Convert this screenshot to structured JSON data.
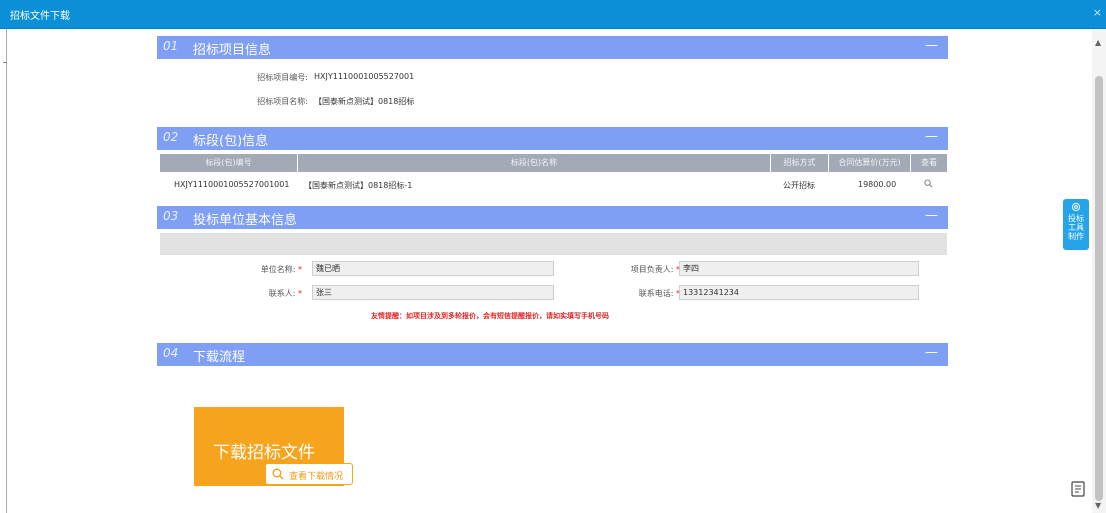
{
  "window": {
    "title": "招标文件下载",
    "close_glyph": "×"
  },
  "sections": [
    {
      "num": "01",
      "name": "招标项目信息",
      "collapse": "—"
    },
    {
      "num": "02",
      "name": "标段(包)信息",
      "collapse": "—"
    },
    {
      "num": "03",
      "name": "投标单位基本信息",
      "collapse": "—"
    },
    {
      "num": "04",
      "name": "下载流程",
      "collapse": "—"
    }
  ],
  "project": {
    "code_label": "招标项目编号:",
    "code_value": "HXJY1110001005527001",
    "name_label": "招标项目名称:",
    "name_value": "【国泰新点测试】0818招标"
  },
  "lot_table": {
    "headers": [
      "标段(包)编号",
      "标段(包)名称",
      "招标方式",
      "合同估算价(万元)",
      "查看"
    ],
    "rows": [
      {
        "code": "HXJY1110001005527001001",
        "name": "【国泰新点测试】0818招标-1",
        "method": "公开招标",
        "price": "19800.00",
        "view_icon": "search-icon"
      }
    ]
  },
  "bidder": {
    "unit_label": "单位名称:",
    "unit_value": "魏已晒",
    "leader_label": "项目负责人:",
    "leader_value": "李四",
    "contact_label": "联系人:",
    "contact_value": "张三",
    "phone_label": "联系电话:",
    "phone_value": "13312341234",
    "required_mark": "*",
    "tip": "友情提醒：如项目涉及到多轮报价，会有短信提醒报价，请如实填写手机号码"
  },
  "download": {
    "button_label": "下载招标文件",
    "view_label": "查看下载情况"
  },
  "side_tool": {
    "label": "投标工具制作",
    "icon": "gear-icon"
  },
  "corner_icon": "document-icon",
  "colors": {
    "titlebar": "#0b8fd6",
    "section_header": "#7f9ff5",
    "table_header": "#a3aab5",
    "download": "#f6a41d",
    "side_tool": "#26a4e9",
    "required": "#e12222"
  }
}
